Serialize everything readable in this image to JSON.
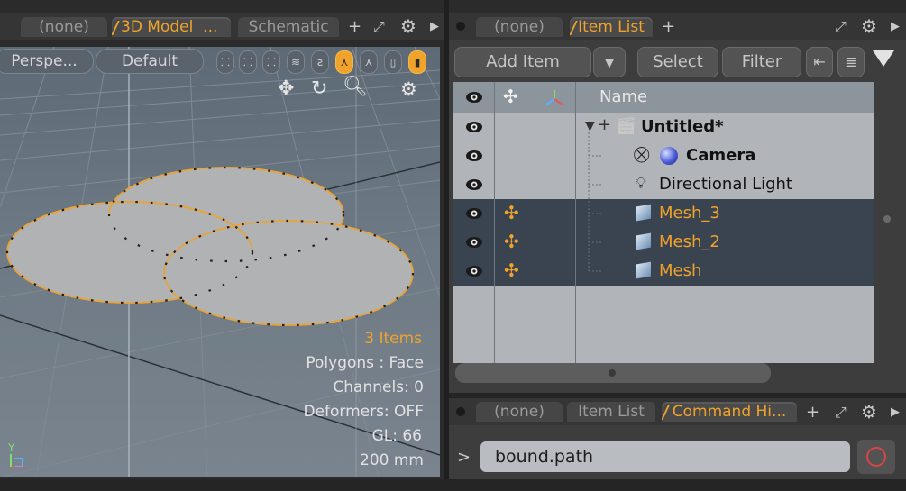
{
  "viewport_panel": {
    "tabs": [
      {
        "label": "(none)"
      },
      {
        "label": "3D Model",
        "ellipsis": "...",
        "active": true
      },
      {
        "label": "Schematic"
      }
    ],
    "view_menu": "Perspe...",
    "shading_menu": "Default",
    "overlay": {
      "items": "3 Items",
      "polygons": "Polygons : Face",
      "channels": "Channels: 0",
      "deformers": "Deformers: OFF",
      "gl": "GL: 66",
      "scale": "200 mm"
    },
    "axis_label": "Y"
  },
  "items_panel": {
    "tabs": [
      {
        "label": "(none)"
      },
      {
        "label": "Item List",
        "active": true
      }
    ],
    "add_item": "Add Item",
    "select": "Select",
    "filter": "Filter",
    "columns": {
      "name": "Name"
    },
    "rows": [
      {
        "label": "Untitled*",
        "icon": "clapperboard-icon",
        "bold": true,
        "selected": false
      },
      {
        "label": "Camera",
        "icon": "camera-icon",
        "bold": true,
        "selected": false
      },
      {
        "label": "Directional Light",
        "icon": "light-icon",
        "bold": false,
        "selected": false
      },
      {
        "label": "Mesh_3",
        "icon": "cube-icon",
        "bold": false,
        "selected": true
      },
      {
        "label": "Mesh_2",
        "icon": "cube-icon",
        "bold": false,
        "selected": true
      },
      {
        "label": "Mesh",
        "icon": "cube-icon",
        "bold": false,
        "selected": true
      }
    ]
  },
  "command_panel": {
    "tabs": [
      {
        "label": "(none)"
      },
      {
        "label": "Item List"
      },
      {
        "label": "Command Hi...",
        "active": true
      }
    ],
    "prompt": ">",
    "command_value": "bound.path"
  },
  "colors": {
    "accent": "#f0a32a",
    "selected_row": "#3a4350",
    "list_bg": "#b1b4b8"
  }
}
